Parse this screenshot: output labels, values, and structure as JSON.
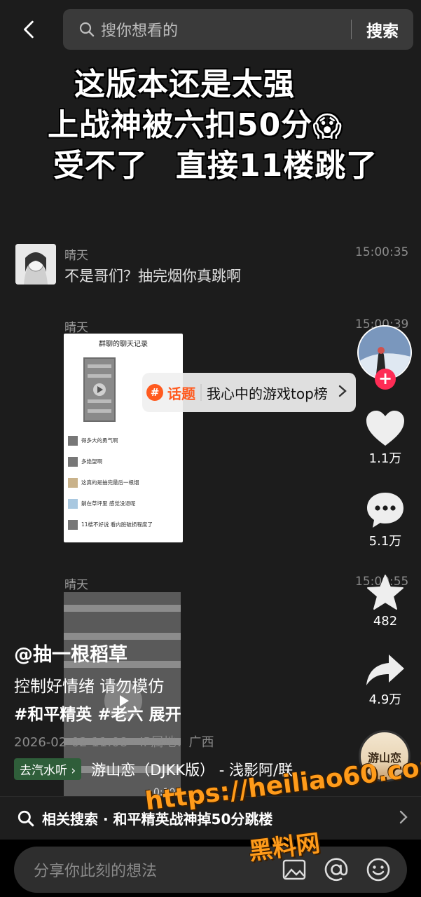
{
  "search": {
    "placeholder": "搜你想看的",
    "button": "搜索"
  },
  "caption": {
    "line1": "这版本还是太强",
    "line2": "上战神被六扣50分",
    "line2_emoji": "😱",
    "line3a": "受不了",
    "line3b": "直接11楼跳了"
  },
  "chat": {
    "msg1": {
      "name": "晴天",
      "time": "15:00:35",
      "text": "不是哥们？抽完烟你真跳啊"
    },
    "msg2": {
      "name": "晴天",
      "time": "15:00:39"
    },
    "msg3": {
      "name": "晴天",
      "time": "15:00:55"
    },
    "screenshot": {
      "header": "群聊的聊天记录",
      "rows": [
        "得多大的勇气啊",
        "多绝望啊",
        "这真的是抽完最后一根烟",
        "躺在草坪里 感觉没退呢",
        "11楼不好说 看内脏破损程度了"
      ]
    },
    "video_duration": "0:10"
  },
  "topic": {
    "label": "话题",
    "text": "我心中的游戏top榜"
  },
  "rail": {
    "like_count": "1.1万",
    "comment_count": "5.1万",
    "favorite_count": "482",
    "share_count": "4.9万",
    "music_disc_text": "游山恋"
  },
  "info": {
    "author": "@抽一根稻草",
    "description": "控制好情绪 请勿模仿",
    "tags": [
      "#和平精英",
      "#老六"
    ],
    "expand": "展开",
    "meta": "2026-02-02 11:08 · IP属地：广西",
    "music_chip": "去汽水听",
    "music_title": "游山恋（DJKK版） - 浅影阿/联"
  },
  "related": {
    "text": "相关搜索 · 和平精英战神掉50分跳楼"
  },
  "comment_bar": {
    "placeholder": "分享你此刻的想法"
  },
  "watermark": {
    "url": "https://heiliao60.com",
    "name": "黑料网"
  },
  "colors": {
    "accent": "#fe2c55",
    "topic": "#ff5a1f",
    "watermark": "#ff9b1a"
  }
}
